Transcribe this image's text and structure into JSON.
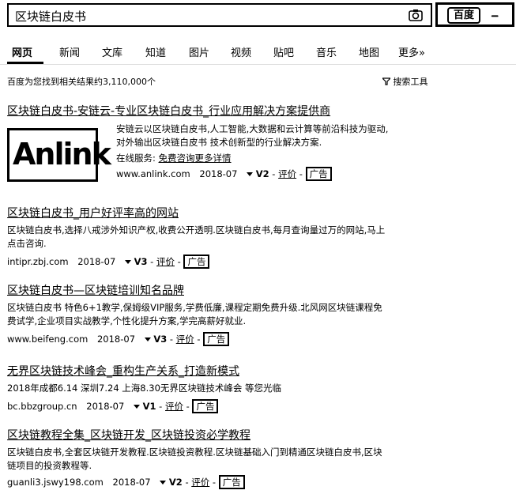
{
  "search": {
    "query": "区块链白皮书",
    "button_label": "百度",
    "button_icon": "baidu-paw-icon"
  },
  "tabs": [
    "网页",
    "新闻",
    "文库",
    "知道",
    "图片",
    "视频",
    "贴吧",
    "音乐",
    "地图",
    "更多»"
  ],
  "stats": "百度为您找到相关结果约3,110,000个",
  "tools_label": "搜索工具",
  "results": [
    {
      "title": "区块链白皮书-安链云-专业区块链白皮书_行业应用解决方案提供商",
      "desc_lines": [
        "安链云以区块链白皮书,人工智能,大数据和云计算等前沿科技为驱动,",
        "对外输出区块链白皮书 技术创新型的行业解决方案."
      ],
      "service_label": "在线服务:",
      "service_link": "免费咨询更多详情",
      "url": "www.anlink.com",
      "date": "2018-07",
      "v": "V2",
      "review": "评价",
      "ad": "广告",
      "logo_text": "Anlink"
    },
    {
      "title": "区块链白皮书_用户好评率高的网站",
      "desc_lines": [
        "区块链白皮书,选择八戒涉外知识产权,收费公开透明.区块链白皮书,每月查询量过万的网站,马上",
        "点击咨询."
      ],
      "url": "intipr.zbj.com",
      "date": "2018-07",
      "v": "V3",
      "review": "评价",
      "ad": "广告"
    },
    {
      "title": "区块链白皮书—区块链培训知名品牌",
      "desc_lines": [
        "区块链白皮书 特色6+1教学,保姆级VIP服务,学费低廉,课程定期免费升级.北风网区块链课程免",
        "费试学,企业项目实战教学,个性化提升方案,学完高薪好就业."
      ],
      "url": "www.beifeng.com",
      "date": "2018-07",
      "v": "V3",
      "review": "评价",
      "ad": "广告"
    },
    {
      "title": "无界区块链技术峰会_重构生产关系_打造新模式",
      "desc_lines": [
        "2018年成都6.14 深圳7.24 上海8.30无界区块链技术峰会 等您光临"
      ],
      "url": "bc.bbzgroup.cn",
      "date": "2018-07",
      "v": "V1",
      "review": "评价",
      "ad": "广告"
    },
    {
      "title": "区块链教程全集_区块链开发_区块链投资必学教程",
      "desc_lines": [
        "区块链白皮书,全套区块链开发教程.区块链投资教程.区块链基础入门到精通区块链白皮书,区块",
        "链项目的投资教程等."
      ],
      "url": "guanli3.jswy198.com",
      "date": "2018-07",
      "v": "V2",
      "review": "评价",
      "ad": "广告"
    }
  ]
}
